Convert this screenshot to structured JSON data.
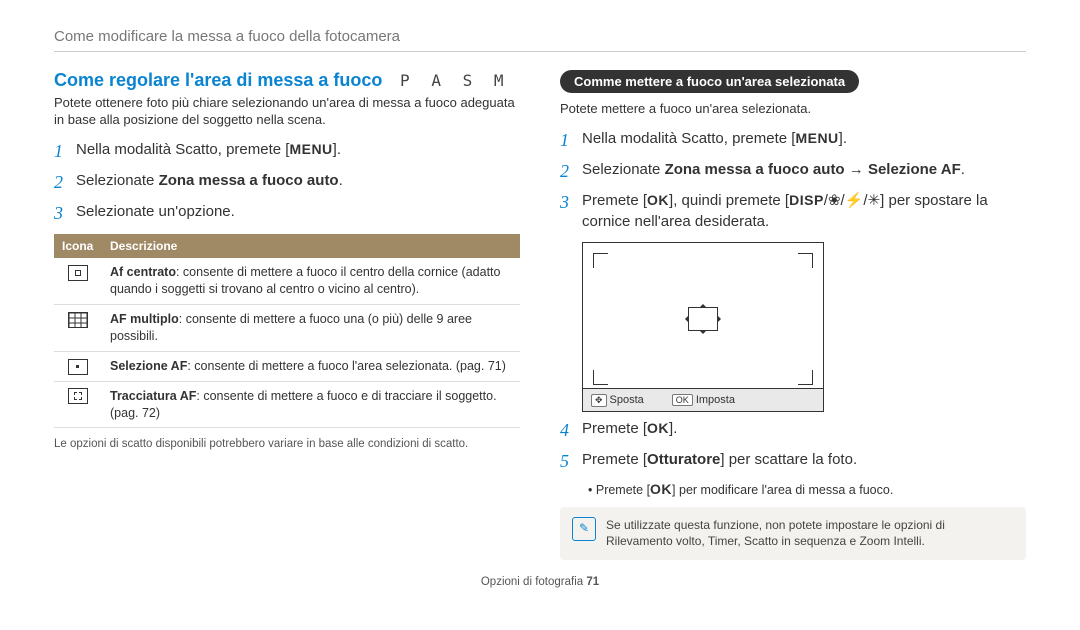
{
  "header": "Come modificare la messa a fuoco della fotocamera",
  "left": {
    "title": "Come regolare l'area di messa a fuoco",
    "modes": "P A S M",
    "intro": "Potete ottenere foto più chiare selezionando un'area di messa a fuoco adeguata in base alla posizione del soggetto nella scena.",
    "step1_a": "Nella modalità Scatto, premete [",
    "step1_btn": "MENU",
    "step1_c": "].",
    "step2_a": "Selezionate ",
    "step2_b": "Zona messa a fuoco auto",
    "step2_c": ".",
    "step3": "Selezionate un'opzione.",
    "table": {
      "h1": "Icona",
      "h2": "Descrizione",
      "r1_b": "Af centrato",
      "r1_t": ": consente di mettere a fuoco il centro della cornice (adatto quando i soggetti si trovano al centro o vicino al centro).",
      "r2_b": "AF multiplo",
      "r2_t": ": consente di mettere a fuoco una (o più) delle 9 aree possibili.",
      "r3_b": "Selezione AF",
      "r3_t": ": consente di mettere a fuoco l'area selezionata. (pag. 71)",
      "r4_b": "Tracciatura AF",
      "r4_t": ": consente di mettere a fuoco e di tracciare il soggetto. (pag. 72)"
    },
    "footnote": "Le opzioni di scatto disponibili potrebbero variare in base alle condizioni di scatto."
  },
  "right": {
    "pill": "Comme mettere a fuoco un'area selezionata",
    "intro": "Potete mettere a fuoco un'area selezionata.",
    "step1_a": "Nella modalità Scatto, premete [",
    "step1_btn": "MENU",
    "step1_c": "].",
    "step2_a": "Selezionate ",
    "step2_b": "Zona messa a fuoco auto",
    "step2_arrow": " → ",
    "step2_c": "Selezione AF",
    "step2_d": ".",
    "step3_a": "Premete [",
    "step3_ok": "OK",
    "step3_b": "], quindi premete [",
    "step3_disp": "DISP",
    "step3_sep": "/",
    "step3_flower": "❀",
    "step3_flash": "⚡",
    "step3_timer": "✳",
    "step3_c": "] per spostare la cornice nell'area desiderata.",
    "bar_move_icon": "✥",
    "bar_move": "Sposta",
    "bar_set_icon": "OK",
    "bar_set": "Imposta",
    "step4_a": "Premete [",
    "step4_ok": "OK",
    "step4_c": "].",
    "step5_a": "Premete [",
    "step5_b": "Otturatore",
    "step5_c": "] per scattare la foto.",
    "tip_a": "Premete [",
    "tip_ok": "OK",
    "tip_c": "] per modificare l'area di messa a fuoco.",
    "note_icon": "✎",
    "note": "Se utilizzate questa funzione, non potete impostare le opzioni di Rilevamento volto, Timer, Scatto in sequenza e Zoom Intelli."
  },
  "footer_a": "Opzioni di fotografia  ",
  "footer_b": "71"
}
